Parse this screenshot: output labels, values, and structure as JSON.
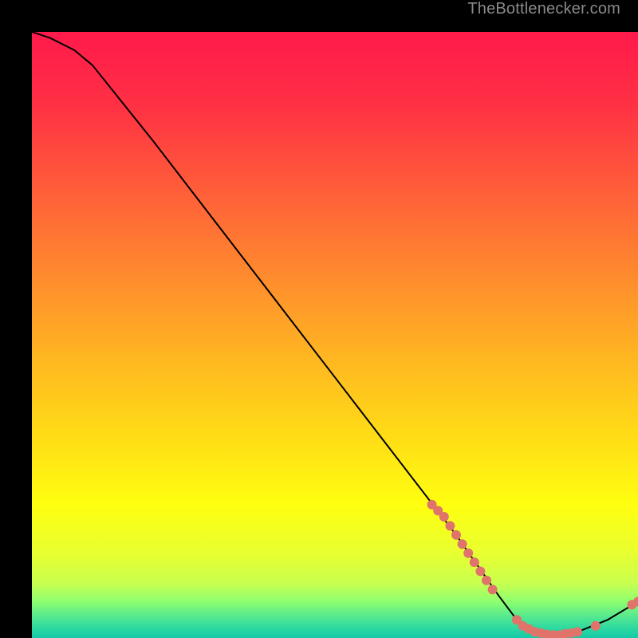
{
  "attribution": "TheBottlenecker.com",
  "chart_data": {
    "type": "line",
    "title": "",
    "xlabel": "",
    "ylabel": "",
    "xlim": [
      0,
      100
    ],
    "ylim": [
      0,
      100
    ],
    "curve": [
      {
        "x": 0,
        "y": 100
      },
      {
        "x": 3,
        "y": 99
      },
      {
        "x": 7,
        "y": 97
      },
      {
        "x": 10,
        "y": 94.5
      },
      {
        "x": 20,
        "y": 82
      },
      {
        "x": 30,
        "y": 69
      },
      {
        "x": 40,
        "y": 56
      },
      {
        "x": 50,
        "y": 43
      },
      {
        "x": 60,
        "y": 30
      },
      {
        "x": 70,
        "y": 17
      },
      {
        "x": 77,
        "y": 7
      },
      {
        "x": 80,
        "y": 3
      },
      {
        "x": 83,
        "y": 1
      },
      {
        "x": 86,
        "y": 0.5
      },
      {
        "x": 90,
        "y": 1
      },
      {
        "x": 95,
        "y": 3
      },
      {
        "x": 100,
        "y": 6
      }
    ],
    "dots": [
      {
        "x": 66,
        "y": 22
      },
      {
        "x": 67,
        "y": 21
      },
      {
        "x": 68,
        "y": 20
      },
      {
        "x": 69,
        "y": 18.5
      },
      {
        "x": 70,
        "y": 17
      },
      {
        "x": 71,
        "y": 15.5
      },
      {
        "x": 72,
        "y": 14
      },
      {
        "x": 73,
        "y": 12.5
      },
      {
        "x": 74,
        "y": 11
      },
      {
        "x": 75,
        "y": 9.5
      },
      {
        "x": 76,
        "y": 8
      },
      {
        "x": 80,
        "y": 3
      },
      {
        "x": 81,
        "y": 2
      },
      {
        "x": 82,
        "y": 1.5
      },
      {
        "x": 83,
        "y": 1
      },
      {
        "x": 84,
        "y": 0.8
      },
      {
        "x": 85,
        "y": 0.6
      },
      {
        "x": 86,
        "y": 0.5
      },
      {
        "x": 87,
        "y": 0.5
      },
      {
        "x": 88,
        "y": 0.7
      },
      {
        "x": 89,
        "y": 0.8
      },
      {
        "x": 90,
        "y": 1
      },
      {
        "x": 93,
        "y": 2
      },
      {
        "x": 99,
        "y": 5.5
      },
      {
        "x": 100,
        "y": 6
      }
    ],
    "gradient_stops": [
      {
        "offset": 0.0,
        "color": "#ff1a4b"
      },
      {
        "offset": 0.12,
        "color": "#ff3044"
      },
      {
        "offset": 0.25,
        "color": "#ff5a3a"
      },
      {
        "offset": 0.4,
        "color": "#ff8a2e"
      },
      {
        "offset": 0.55,
        "color": "#ffba20"
      },
      {
        "offset": 0.68,
        "color": "#ffe015"
      },
      {
        "offset": 0.78,
        "color": "#ffff10"
      },
      {
        "offset": 0.86,
        "color": "#e8ff30"
      },
      {
        "offset": 0.91,
        "color": "#c8ff50"
      },
      {
        "offset": 0.94,
        "color": "#8dff70"
      },
      {
        "offset": 0.965,
        "color": "#55e890"
      },
      {
        "offset": 0.985,
        "color": "#2ad8a0"
      },
      {
        "offset": 1.0,
        "color": "#16c9a8"
      }
    ],
    "dot_color": "#e0736a",
    "line_color": "#000000"
  }
}
